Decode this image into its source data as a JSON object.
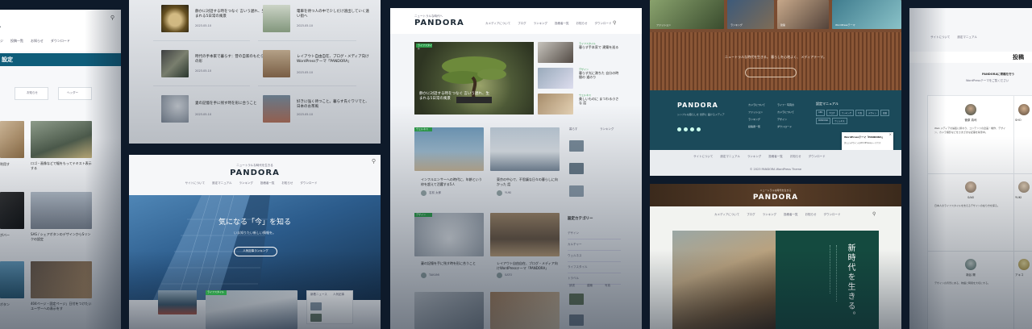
{
  "colors": {
    "bg": "#0e1a2a",
    "teal": "#0f5d7a",
    "green": "#2e9c4a",
    "darkteal": "#1b4a5a",
    "forest": "#144a3f"
  },
  "brand": {
    "logo": "PANDORA",
    "tagline": "ニュートラルな時代へ",
    "tagline_long": "ニュートラルな時代を生きる",
    "logo_alt": "PANDORA"
  },
  "panel1": {
    "nav": [
      "ジ",
      "投稿一覧",
      "お知らせ",
      "ダウンロード"
    ],
    "section_title": "設定",
    "tabs": [
      "お知らせ",
      "ヘッダー"
    ],
    "cards": [
      {
        "title": "利用す",
        "date": ""
      },
      {
        "title": "ロゴ・画像などで幅をもってテキスト表示する",
        "date": ""
      },
      {
        "title": "がバー",
        "date": ""
      },
      {
        "title": "SAS / シェアボタンのデザインからSリンクの設定",
        "date": ""
      },
      {
        "title": "ボタン",
        "date": ""
      },
      {
        "title": "404ページ・固定ページ」日付をつけたいユーザーへの表示をす",
        "date": ""
      }
    ]
  },
  "panel2": {
    "items": [
      {
        "title": "静かに対話する時をつなぐ 言いう遅れ、生まれる5日常の風景",
        "date": "2023.05.10"
      },
      {
        "title": "電車を待つ人の中で少しだけ遠出していく遠い街へ",
        "date": "2023.05.10"
      },
      {
        "title": "時代の手本家で暮らす：昔の自家のもたらすの形",
        "date": "2023.05.10"
      },
      {
        "title": "レイアウト自由自在、ブログ・メディア向けWordPressテーマ「PANDORA」",
        "date": "2023.05.10"
      },
      {
        "title": "妻の記憶を手に残す時を形に合うこと",
        "date": "2023.05.10"
      },
      {
        "title": "好きに強く待つこと。暮らす氏ぐワリでと、日本のお茶風",
        "date": "2023.05.10"
      }
    ]
  },
  "panel3": {
    "tagline": "ニュートラルな時代を生きる",
    "nav": [
      "サイトについて",
      "設定マニュアル",
      "ランキング",
      "投稿者一覧",
      "お知らせ",
      "ダウンロード"
    ],
    "hero_title": "気になる「今」を知る",
    "hero_sub": "いま知りたい新しい情報を。",
    "hero_button": "人気記事ランキング",
    "sidebar_tabs": [
      "新着ニュース",
      "人気記事"
    ],
    "badge": "ライフスタイル"
  },
  "panel4": {
    "nav": [
      "カメディアについて",
      "ブログ",
      "ランキング",
      "投稿者一覧",
      "お知らせ",
      "ダウンロード"
    ],
    "hero_title": "静かに対話する時をつなぐ 言いう遅れ、生まれる5日常の風景",
    "side_labels": [
      "ライフスタイル",
      "デザイン",
      "ウェルネス"
    ],
    "side_titles": [
      "暮らす手本家で 建築を巡る",
      "暮らす光に満ちた 自分の時間の 道のり",
      "美しいものに まつわる小さな 話"
    ],
    "badges": [
      "ウェルネス",
      "デザイン",
      "ライフスタイル"
    ],
    "cards": [
      {
        "title": "インフルエンサーへの時代に、年齢という枠を超えて活躍する5人",
        "author": "名前 太郎"
      },
      {
        "title": "東京の中心で、不思議な日々の暮らしに向かった 話",
        "author": "YUKI"
      },
      {
        "title": "妻の記憶を手に残す時を形に合うこと",
        "author": "TAKUMI"
      },
      {
        "title": "レイアウト自由自在、ブログ・メディア向けWordPressテーマ「PANDORA」",
        "author": "SATO"
      }
    ],
    "sidebar_ranking": [
      "暮らす",
      "ランキング",
      "記事"
    ],
    "category_title": "設定カテゴリー",
    "categories": [
      "デザイン",
      "カルチャー",
      "ウェルネス",
      "ライフスタイル",
      "トラベル"
    ],
    "tags": [
      "読書",
      "建築",
      "写真"
    ]
  },
  "panel5": {
    "thumbs": [
      "ファッション",
      "ランキング",
      "建築",
      "WordPressテーマ"
    ],
    "intro": "ニュートラルな時代を生きる。 暮らしを心地よく、 メディアテーマ。",
    "footer_logo": "PANDORA",
    "footer_desc": "シンプルな暮らしを 世界に 届けるメディア",
    "footer_col1": [
      "カメラについて",
      "ファッション",
      "ランキング",
      "投稿者一覧"
    ],
    "footer_col2": [
      "ライフ・写真の",
      "カメラについて",
      "デザイン",
      "ダウンロード"
    ],
    "footer_col3_title": "設定マニュアル",
    "tags": [
      "ARS",
      "ブログ",
      "ランキング",
      "写真",
      "デザイン",
      "投稿",
      "PANDORA",
      "ウェルネス"
    ],
    "popup_title": "WordPressテーマ「PANDORA」",
    "popup_text": "美しいデザインのWordPressテーマです",
    "popup_button": "今すぐダウンロード",
    "bottom_nav": [
      "サイトについて",
      "設定マニュアル",
      "ランキング",
      "投稿者一覧",
      "お知らせ",
      "ダウンロード"
    ],
    "copyright": "© 2023 PANDORA WordPress Theme",
    "tagline2": "ニュートラルな時代を生きる",
    "nav2": [
      "カメディアについて",
      "ブログ",
      "ランキング",
      "投稿者一覧",
      "お知らせ",
      "ダウンロード"
    ],
    "hero_vertical": "新時代を生きる。"
  },
  "panel6": {
    "nav": [
      "サイトについて",
      "設定マニュアル"
    ],
    "title": "投稿",
    "subtitle": "PANDORAに寄稿を行う",
    "desc": "WordPressテーマをご覧ください",
    "authors": [
      {
        "name": "菅原 真司",
        "bio": "Web メディアの編集に携わり、コンテンツの企画・制作、デザイン、カメラ撮影などをさまざまな記事を執筆中。"
      },
      {
        "name": "SHO",
        "bio": "写真と本をキャンプで楽しむ。"
      },
      {
        "name": "SAKI",
        "bio": "日本人のライフスタイルを支えるデザインの在り方を探る。"
      },
      {
        "name": "YUKI",
        "bio": "旅をしながら多くの人と出会う。"
      },
      {
        "name": "新谷 陽",
        "bio": "デザインの背景にある、物語と時間を大切にする。"
      },
      {
        "name": "アキコ",
        "bio": "暮らしに寄り添うデザインを。"
      }
    ]
  }
}
